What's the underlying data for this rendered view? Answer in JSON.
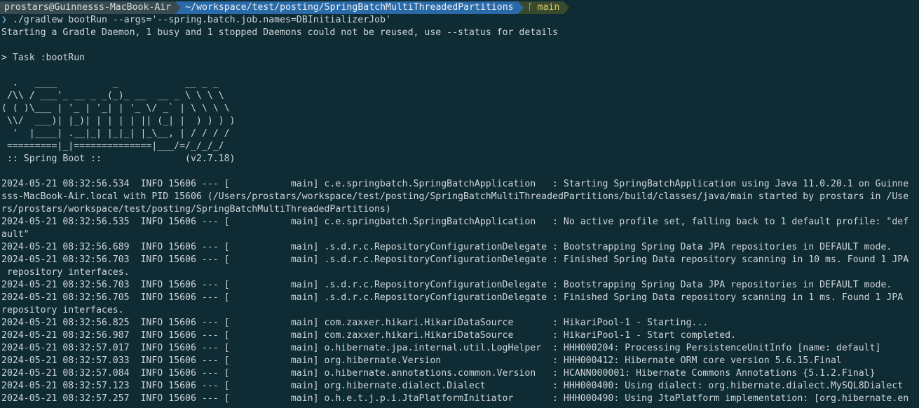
{
  "prompt": {
    "user_host": "prostars@Guinnesss-MacBook-Air",
    "path": "~/workspace/test/posting/SpringBatchMultiThreadedPartitions",
    "branch": "main"
  },
  "command": "./gradlew bootRun --args='--spring.batch.job.names=DBInitializerJob'",
  "daemon_msg": "Starting a Gradle Daemon, 1 busy and 1 stopped Daemons could not be reused, use --status for details",
  "task_line": "> Task :bootRun",
  "banner": [
    "  .   ____          _            __ _ _",
    " /\\\\ / ___'_ __ _ _(_)_ __  __ _ \\ \\ \\ \\",
    "( ( )\\___ | '_ | '_| | '_ \\/ _` | \\ \\ \\ \\",
    " \\\\/  ___)| |_)| | | | | || (_| |  ) ) ) )",
    "  '  |____| .__|_| |_|_| |_\\__, | / / / /",
    " =========|_|==============|___/=/_/_/_/",
    " :: Spring Boot ::               (v2.7.18)"
  ],
  "log_lines": [
    "2024-05-21 08:32:56.534  INFO 15606 --- [           main] c.e.springbatch.SpringBatchApplication   : Starting SpringBatchApplication using Java 11.0.20.1 on Guinne",
    "sss-MacBook-Air.local with PID 15606 (/Users/prostars/workspace/test/posting/SpringBatchMultiThreadedPartitions/build/classes/java/main started by prostars in /Use",
    "rs/prostars/workspace/test/posting/SpringBatchMultiThreadedPartitions)",
    "2024-05-21 08:32:56.535  INFO 15606 --- [           main] c.e.springbatch.SpringBatchApplication   : No active profile set, falling back to 1 default profile: \"def",
    "ault\"",
    "2024-05-21 08:32:56.689  INFO 15606 --- [           main] .s.d.r.c.RepositoryConfigurationDelegate : Bootstrapping Spring Data JPA repositories in DEFAULT mode.",
    "2024-05-21 08:32:56.703  INFO 15606 --- [           main] .s.d.r.c.RepositoryConfigurationDelegate : Finished Spring Data repository scanning in 10 ms. Found 1 JPA",
    " repository interfaces.",
    "2024-05-21 08:32:56.703  INFO 15606 --- [           main] .s.d.r.c.RepositoryConfigurationDelegate : Bootstrapping Spring Data JPA repositories in DEFAULT mode.",
    "2024-05-21 08:32:56.705  INFO 15606 --- [           main] .s.d.r.c.RepositoryConfigurationDelegate : Finished Spring Data repository scanning in 1 ms. Found 1 JPA",
    "repository interfaces.",
    "2024-05-21 08:32:56.825  INFO 15606 --- [           main] com.zaxxer.hikari.HikariDataSource       : HikariPool-1 - Starting...",
    "2024-05-21 08:32:56.987  INFO 15606 --- [           main] com.zaxxer.hikari.HikariDataSource       : HikariPool-1 - Start completed.",
    "2024-05-21 08:32:57.017  INFO 15606 --- [           main] o.hibernate.jpa.internal.util.LogHelper  : HHH000204: Processing PersistenceUnitInfo [name: default]",
    "2024-05-21 08:32:57.033  INFO 15606 --- [           main] org.hibernate.Version                    : HHH000412: Hibernate ORM core version 5.6.15.Final",
    "2024-05-21 08:32:57.084  INFO 15606 --- [           main] o.hibernate.annotations.common.Version   : HCANN000001: Hibernate Commons Annotations {5.1.2.Final}",
    "2024-05-21 08:32:57.123  INFO 15606 --- [           main] org.hibernate.dialect.Dialect            : HHH000400: Using dialect: org.hibernate.dialect.MySQL8Dialect",
    "2024-05-21 08:32:57.257  INFO 15606 --- [           main] o.h.e.t.j.p.i.JtaPlatformInitiator       : HHH000490: Using JtaPlatform implementation: [org.hibernate.en"
  ],
  "colors": {
    "background": "#0f2b34",
    "text": "#cfd6d8",
    "path_segment": "#2a6aa8",
    "git_branch": "#d8d06a"
  },
  "icons": {
    "branch": "git-branch-icon"
  }
}
